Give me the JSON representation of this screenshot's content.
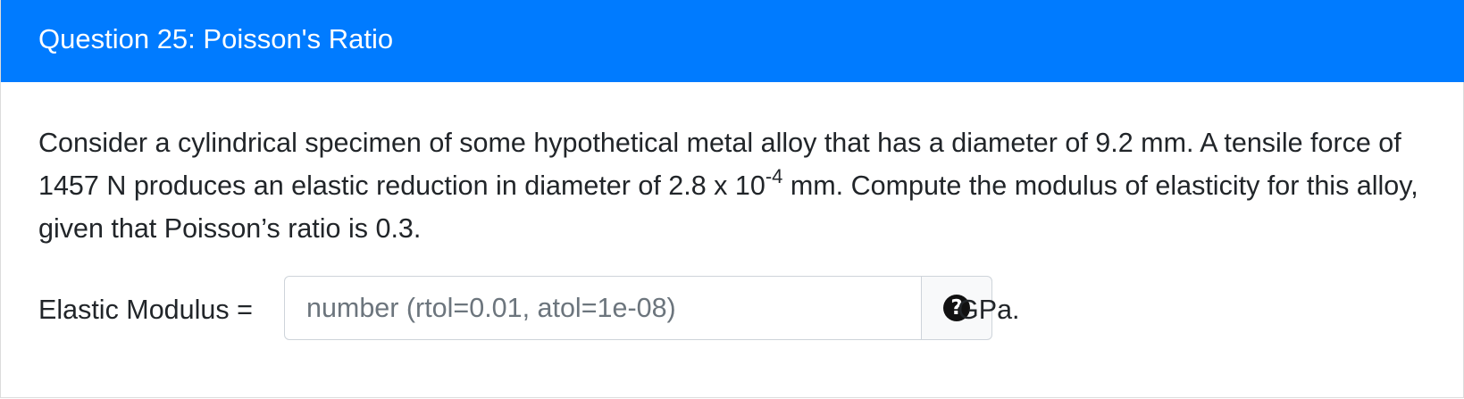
{
  "header": {
    "title": "Question 25: Poisson's Ratio"
  },
  "question": {
    "text_part1": "Consider a cylindrical specimen of some hypothetical metal alloy that has a diameter of 9.2 mm. A tensile force of 1457 N produces an elastic reduction in diameter of 2.8 x 10",
    "exponent": "-4",
    "text_part2": " mm. Compute the modulus of elasticity for this alloy, given that Poisson’s ratio is 0.3."
  },
  "answer": {
    "label": "Elastic Modulus =",
    "value": "",
    "placeholder": "number (rtol=0.01, atol=1e-08)",
    "help_icon": "question-circle-icon",
    "help_glyph": "?",
    "unit": "GPa."
  },
  "colors": {
    "header_bg": "#007bff",
    "header_text": "#ffffff",
    "body_text": "#212529",
    "placeholder": "#6c757d"
  }
}
